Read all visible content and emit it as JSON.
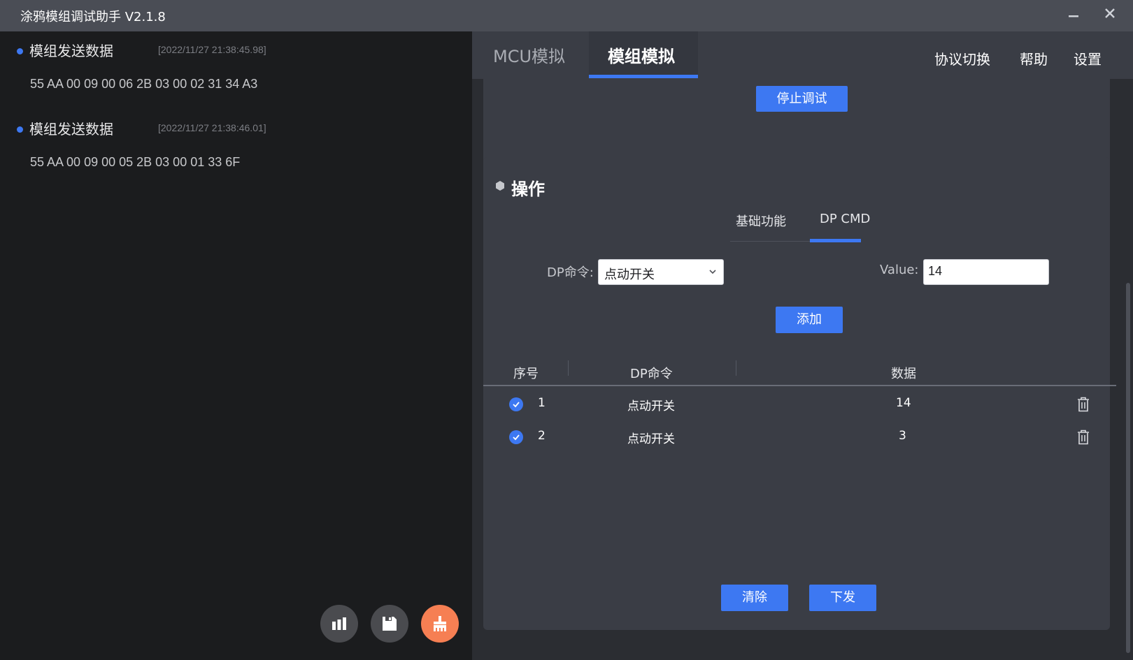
{
  "window": {
    "title": "涂鸦模组调试助手 V2.1.8",
    "minimize_icon": "minimize-icon",
    "close_icon": "close-icon"
  },
  "log": {
    "entries": [
      {
        "title": "模组发送数据",
        "time": "[2022/11/27 21:38:45.98]",
        "data": "55 AA 00 09 00 06 2B 03 00 02 31 34 A3"
      },
      {
        "title": "模组发送数据",
        "time": "[2022/11/27 21:38:46.01]",
        "data": "55 AA 00 09 00 05 2B 03 00 01 33 6F"
      }
    ],
    "buttons": [
      "bar-chart-icon",
      "save-icon",
      "clear-brush-icon"
    ]
  },
  "tabs": {
    "mcu": "MCU模拟",
    "module": "模组模拟",
    "active": "模组模拟"
  },
  "menu": {
    "protocol": "协议切换",
    "help": "帮助",
    "settings": "设置"
  },
  "debug": {
    "stop_label": "停止调试"
  },
  "operation": {
    "title": "操作",
    "subtabs": [
      "基础功能",
      "DP CMD"
    ],
    "active_subtab": "DP CMD",
    "dp_label": "DP命令:",
    "dp_selected": "点动开关",
    "value_label": "Value:",
    "value": "14",
    "add_label": "添加",
    "table": {
      "headers": [
        "序号",
        "DP命令",
        "数据"
      ],
      "rows": [
        {
          "index": "1",
          "dp": "点动开关",
          "data": "14"
        },
        {
          "index": "2",
          "dp": "点动开关",
          "data": "3"
        }
      ]
    },
    "clear_label": "清除",
    "send_label": "下发"
  },
  "colors": {
    "accent": "#3d78f2",
    "orange": "#f67f53",
    "titlebar": "#4a4d55",
    "left_bg": "#1b1c1e",
    "card_bg": "#3a3d45"
  }
}
